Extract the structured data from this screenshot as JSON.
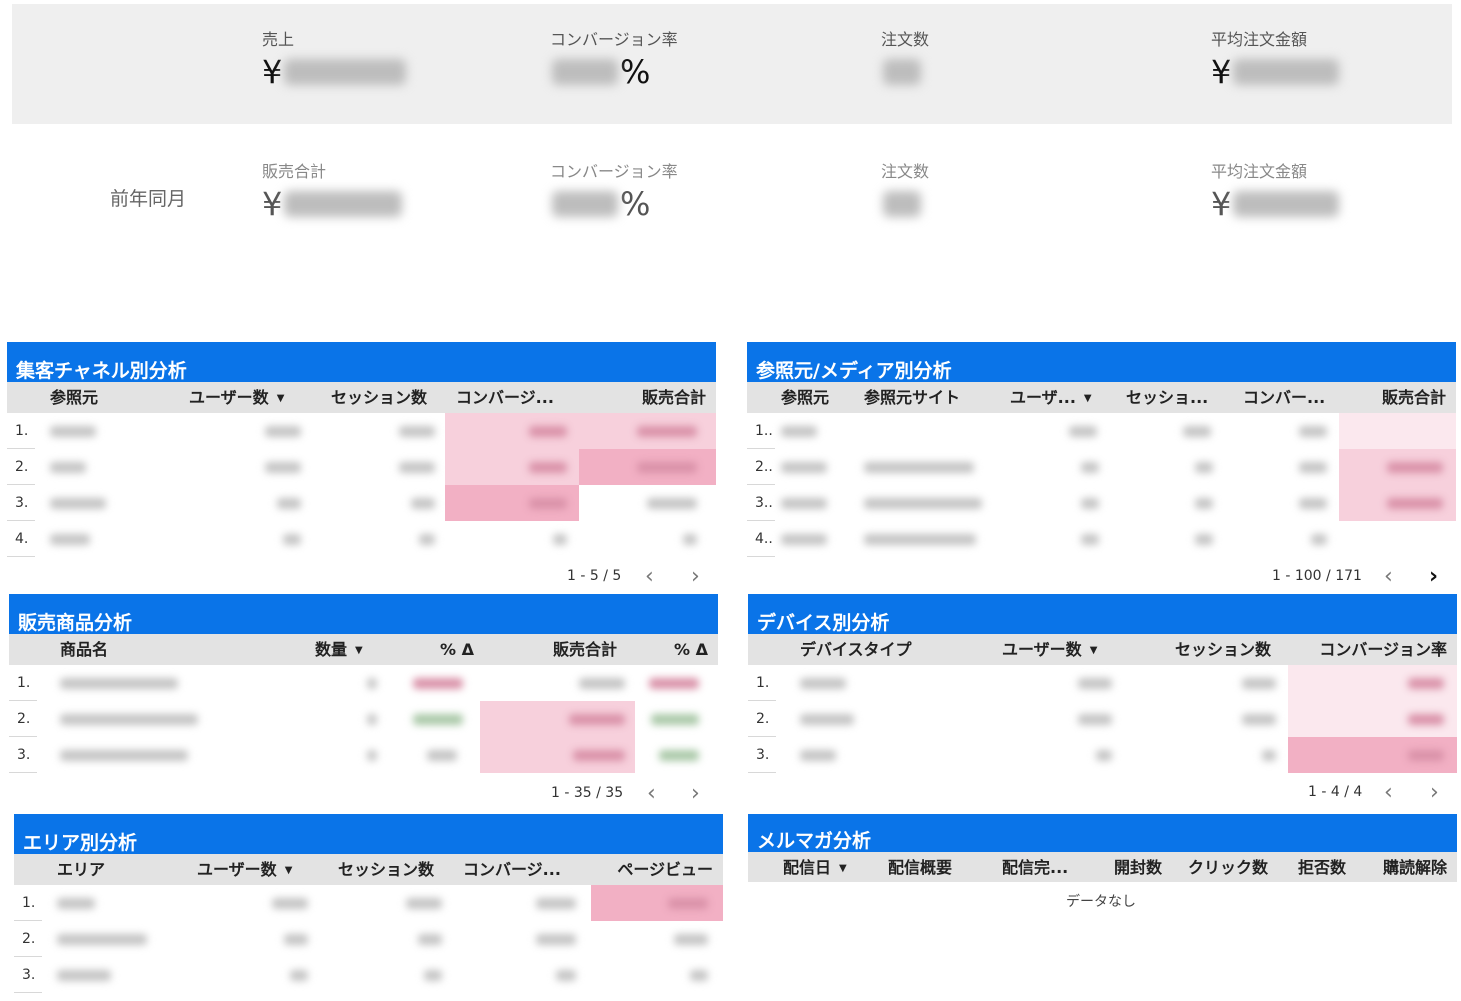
{
  "kpi_current": {
    "sales_label": "売上",
    "sales_prefix": "¥",
    "cvr_label": "コンバージョン率",
    "cvr_suffix": "%",
    "orders_label": "注文数",
    "aov_label": "平均注文金額",
    "aov_prefix": "¥"
  },
  "kpi_previous": {
    "row_label": "前年同月",
    "sales_label": "販売合計",
    "sales_prefix": "¥",
    "cvr_label": "コンバージョン率",
    "cvr_suffix": "%",
    "orders_label": "注文数",
    "aov_label": "平均注文金額",
    "aov_prefix": "¥"
  },
  "channel_panel": {
    "title": "集客チャネル別分析",
    "columns": [
      "参照元",
      "ユーザー数",
      "セッション数",
      "コンバージ...",
      "販売合計"
    ],
    "sort_arrow": "▼",
    "row_numbers": [
      "1.",
      "2.",
      "3.",
      "4."
    ],
    "pager": "1 - 5 / 5",
    "prev": "‹",
    "next": "›"
  },
  "referrer_panel": {
    "title": "参照元/メディア別分析",
    "columns": [
      "参照元",
      "参照元サイト",
      "ユーザ...",
      "セッショ...",
      "コンバー...",
      "販売合計"
    ],
    "sort_arrow": "▼",
    "row_numbers": [
      "1..",
      "2..",
      "3..",
      "4.."
    ],
    "pager": "1 - 100 / 171",
    "prev": "‹",
    "next": "›"
  },
  "product_panel": {
    "title": "販売商品分析",
    "columns": [
      "商品名",
      "数量",
      "% Δ",
      "販売合計",
      "% Δ"
    ],
    "sort_arrow": "▼",
    "row_numbers": [
      "1.",
      "2.",
      "3."
    ],
    "pager": "1 - 35 / 35",
    "prev": "‹",
    "next": "›"
  },
  "device_panel": {
    "title": "デバイス別分析",
    "columns": [
      "デバイスタイプ",
      "ユーザー数",
      "セッション数",
      "コンバージョン率"
    ],
    "sort_arrow": "▼",
    "row_numbers": [
      "1.",
      "2.",
      "3."
    ],
    "pager": "1 - 4 / 4",
    "prev": "‹",
    "next": "›"
  },
  "area_panel": {
    "title": "エリア別分析",
    "columns": [
      "エリア",
      "ユーザー数",
      "セッション数",
      "コンバージ...",
      "ページビュー"
    ],
    "sort_arrow": "▼",
    "row_numbers": [
      "1.",
      "2.",
      "3."
    ]
  },
  "mail_panel": {
    "title": "メルマガ分析",
    "columns": [
      "配信日",
      "配信概要",
      "配信完...",
      "開封数",
      "クリック数",
      "拒否数",
      "購読解除"
    ],
    "sort_arrow": "▼",
    "empty_text": "データなし"
  }
}
